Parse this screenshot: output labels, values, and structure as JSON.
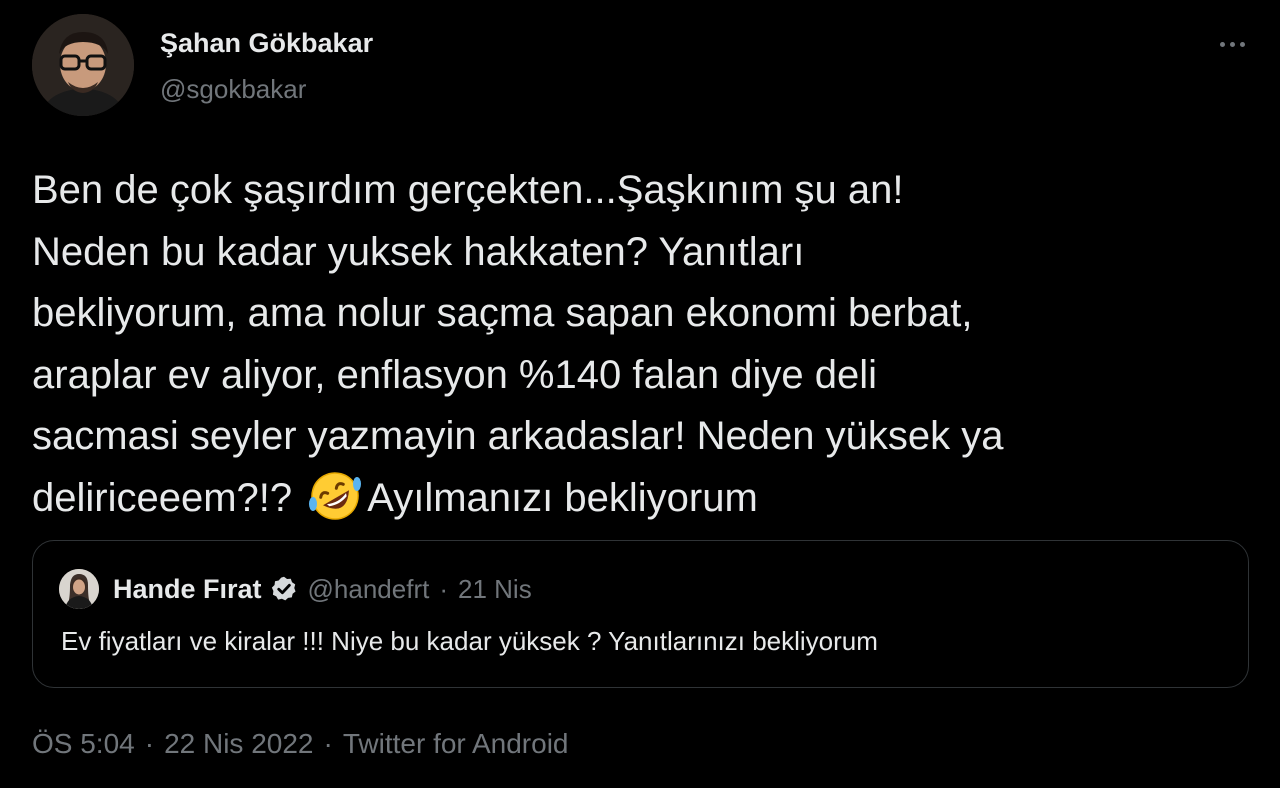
{
  "author": {
    "name": "Şahan Gökbakar",
    "handle": "@sgokbakar"
  },
  "menu_icon": "more-horizontal-icon",
  "tweet": {
    "lines": [
      "Ben de çok şaşırdım gerçekten...Şaşkınım şu an!",
      "Neden bu kadar yuksek hakkaten? Yanıtları",
      "bekliyorum, ama nolur saçma sapan ekonomi berbat,",
      "araplar ev aliyor, enflasyon %140 falan diye deli",
      "sacmasi seyler yazmayin arkadaslar! Neden yüksek ya"
    ],
    "last_line_before_emoji": "deliriceeem?!? ",
    "emoji": "rolling-on-the-floor-laughing-emoji",
    "last_line_after_emoji": "Ayılmanızı bekliyorum"
  },
  "quoted_tweet": {
    "author_name": "Hande Fırat",
    "verified_icon": "verified-badge-icon",
    "handle": "@handefrt",
    "separator": "·",
    "date": "21 Nis",
    "text": "Ev fiyatları ve kiralar !!! Niye bu kadar yüksek ? Yanıtlarınızı bekliyorum"
  },
  "meta": {
    "time": "ÖS 5:04",
    "separator": "·",
    "date": "22 Nis 2022",
    "source": "Twitter for Android"
  },
  "colors": {
    "background": "#000000",
    "primary_text": "#e7e9ea",
    "secondary_text": "#71767b",
    "border": "#2f3336"
  }
}
